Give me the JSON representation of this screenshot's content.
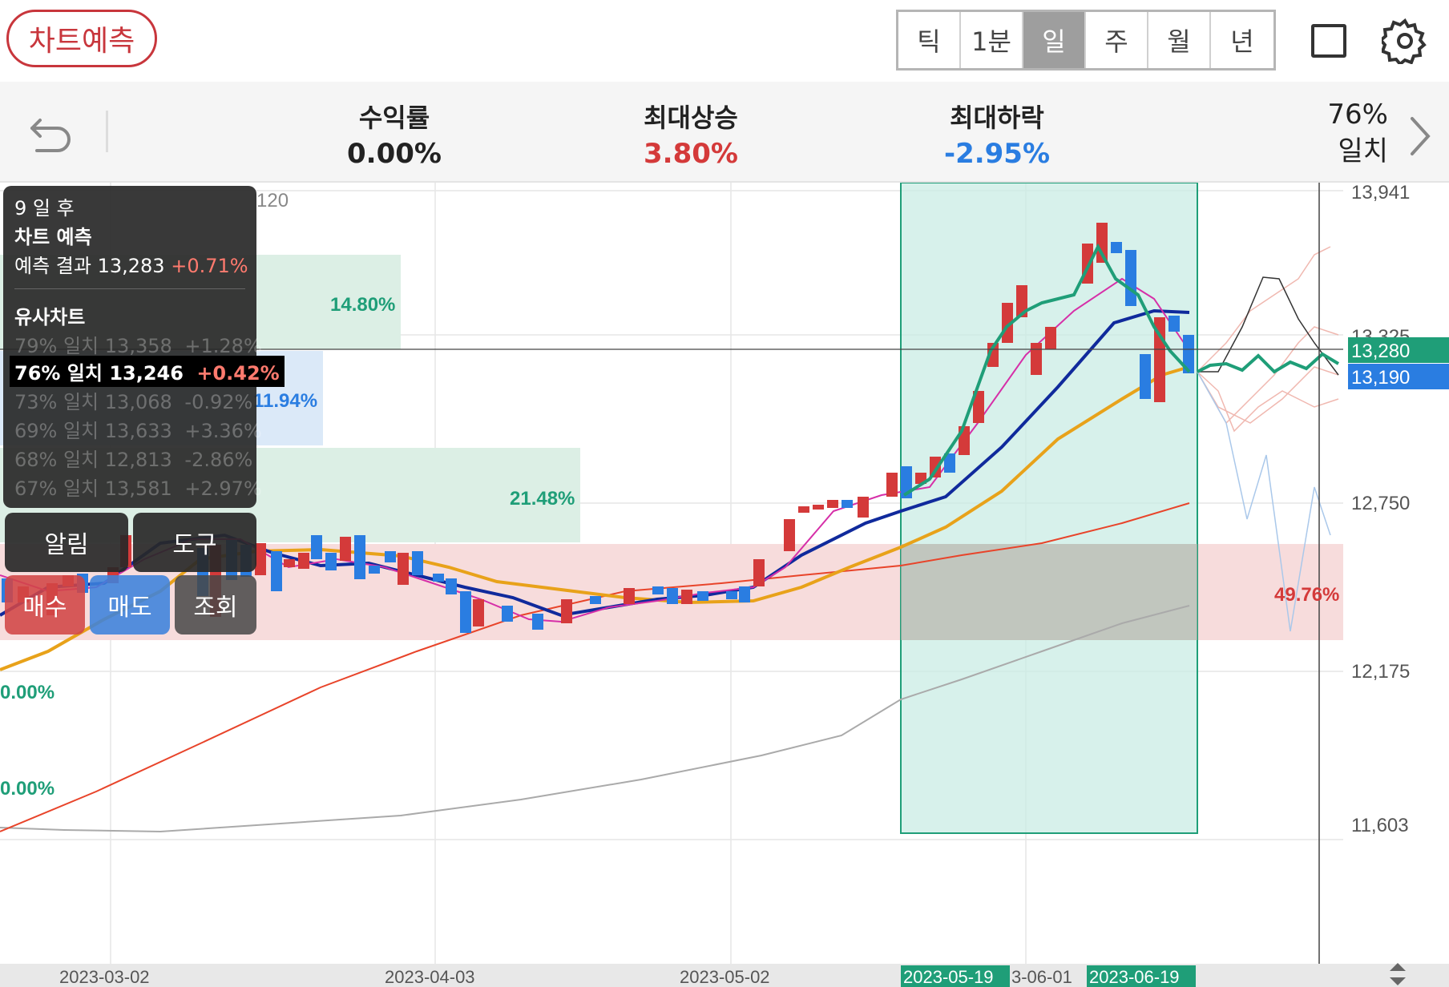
{
  "topbar": {
    "predict_label": "차트예측",
    "periods": [
      "틱",
      "1분",
      "일",
      "주",
      "월",
      "년"
    ],
    "active_period": "일"
  },
  "stats": {
    "return_label": "수익률",
    "return_value": "0.00%",
    "max_up_label": "최대상승",
    "max_up_value": "3.80%",
    "max_down_label": "최대하락",
    "max_down_value": "-2.95%",
    "match_pct": "76%",
    "match_label": "일치"
  },
  "chart": {
    "y_ticks": [
      "13,941",
      "13,325",
      "12,750",
      "12,175",
      "11,603"
    ],
    "x_ticks": [
      "2023-03-02",
      "2023-04-03",
      "2023-05-02",
      "2023-05-19",
      "3-06-01",
      "2023-06-19"
    ],
    "price_tag_green": "13,280",
    "price_tag_blue": "13,190",
    "zone_labels": [
      "14.80%",
      "11.94%",
      "21.48%",
      "49.76%",
      "0.00%",
      "0.00%"
    ],
    "legend_partial": "120",
    "colors": {
      "up": "#d43a3a",
      "down": "#2a7de1",
      "ma5": "#d62fa8",
      "ma10": "#102a9c",
      "ma20": "#e8a21a",
      "ma60": "#e8442a",
      "ma120": "#aaaaaa",
      "pattern": "#1f9e78"
    }
  },
  "overlay": {
    "days_after": "9 일 후",
    "title": "차트 예측",
    "result_label": "예측 결과",
    "result_value": "13,283",
    "result_change": "+0.71%",
    "similar_title": "유사차트",
    "similar": [
      {
        "match": "79% 일치",
        "price": "13,358",
        "change": "+1.28%"
      },
      {
        "match": "76% 일치",
        "price": "13,246",
        "change": "+0.42%"
      },
      {
        "match": "73% 일치",
        "price": "13,068",
        "change": "-0.92%"
      },
      {
        "match": "69% 일치",
        "price": "13,633",
        "change": "+3.36%"
      },
      {
        "match": "68% 일치",
        "price": "12,813",
        "change": "-2.86%"
      },
      {
        "match": "67% 일치",
        "price": "13,581",
        "change": "+2.97%"
      }
    ],
    "selected_index": 1
  },
  "actions": {
    "alarm": "알림",
    "tool": "도구",
    "buy": "매수",
    "sell": "매도",
    "view": "조회"
  }
}
